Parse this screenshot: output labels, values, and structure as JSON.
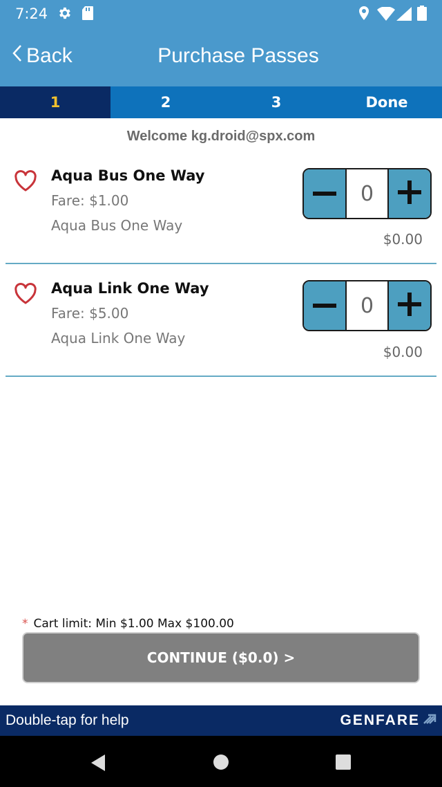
{
  "status_bar": {
    "time": "7:24",
    "icons": [
      "gear-icon",
      "sd-card-icon",
      "location-icon",
      "wifi-icon",
      "signal-icon",
      "battery-icon"
    ]
  },
  "header": {
    "back_label": "Back",
    "title": "Purchase Passes"
  },
  "steps": [
    {
      "label": "1",
      "active": true
    },
    {
      "label": "2",
      "active": false
    },
    {
      "label": "3",
      "active": false
    },
    {
      "label": "Done",
      "active": false
    }
  ],
  "welcome": "Welcome kg.droid@spx.com",
  "passes": [
    {
      "name": "Aqua Bus One Way",
      "fare": "Fare: $1.00",
      "description": "Aqua Bus One Way",
      "quantity": "0",
      "total": "$0.00"
    },
    {
      "name": "Aqua Link One Way",
      "fare": "Fare: $5.00",
      "description": "Aqua Link One Way",
      "quantity": "0",
      "total": "$0.00"
    }
  ],
  "cart_limit": {
    "marker": "*",
    "text": "Cart limit: Min $1.00 Max $100.00"
  },
  "continue_label": "CONTINUE ($0.0) >",
  "footer": {
    "help": "Double-tap for help",
    "brand": "GENFARE"
  },
  "colors": {
    "header_blue": "#4a99cc",
    "step_blue": "#0e72bb",
    "navy": "#0a2a64",
    "active_step": "#f2c12e",
    "stepper_blue": "#4d9fc0",
    "heart_red": "#c8343a",
    "button_gray": "#808080"
  }
}
